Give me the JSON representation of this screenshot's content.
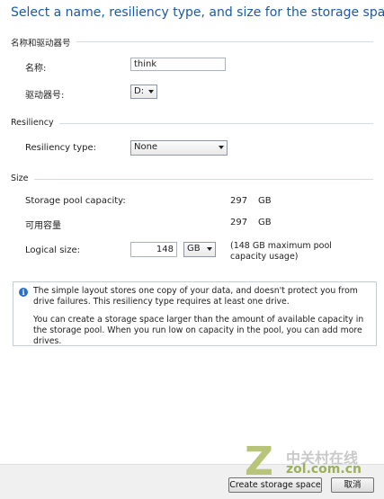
{
  "heading": "Select a name, resiliency type, and size for the storage space",
  "sections": {
    "name_drive": "名称和驱动器号",
    "resiliency": "Resiliency",
    "size": "Size"
  },
  "fields": {
    "name_label": "名称:",
    "name_value": "think",
    "drive_label": "驱动器号:",
    "drive_value": "D:",
    "resiliency_label": "Resiliency type:",
    "resiliency_value": "None",
    "pool_capacity_label": "Storage pool capacity:",
    "pool_capacity_value": "297",
    "pool_capacity_unit": "GB",
    "available_label": "可用容量",
    "available_value": "297",
    "available_unit": "GB",
    "logical_size_label": "Logical size:",
    "logical_size_value": "148",
    "logical_size_unit": "GB",
    "logical_size_hint": "(148 GB maximum pool capacity usage)"
  },
  "info": {
    "line1": "The simple layout stores one copy of your data, and doesn't protect you from drive failures. This resiliency type requires at least one drive.",
    "line2": "You can create a storage space larger than the amount of available capacity in the storage pool. When you run low on capacity in the pool, you can add more drives."
  },
  "buttons": {
    "create": "Create storage space",
    "cancel": "取消"
  },
  "watermark": {
    "letter": "Z",
    "cn": "中关村在线",
    "en": "zol.com.cn"
  }
}
